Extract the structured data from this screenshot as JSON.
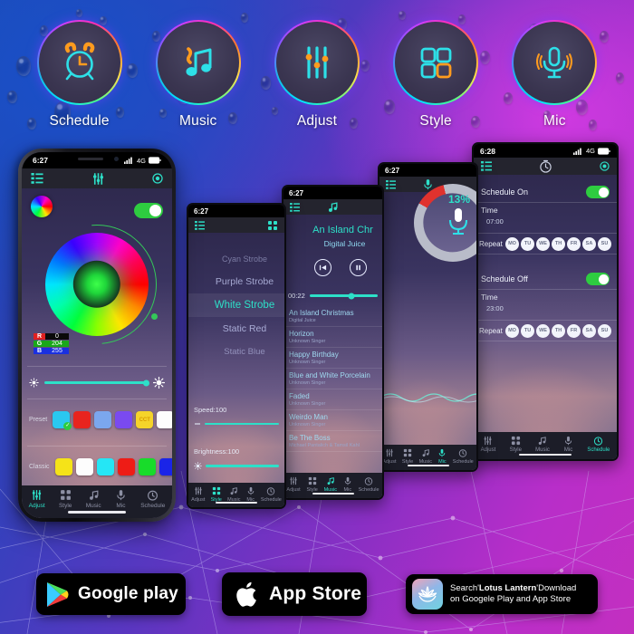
{
  "features": [
    {
      "label": "Schedule",
      "icon": "alarm-clock-icon"
    },
    {
      "label": "Music",
      "icon": "music-note-icon"
    },
    {
      "label": "Adjust",
      "icon": "sliders-icon"
    },
    {
      "label": "Style",
      "icon": "grid-squares-icon"
    },
    {
      "label": "Mic",
      "icon": "microphone-icon"
    }
  ],
  "nav": {
    "adjust": "Adjust",
    "style": "Style",
    "music": "Music",
    "mic": "Mic",
    "schedule": "Schedule"
  },
  "phone_adjust": {
    "status": {
      "time": "6:27",
      "network": "4G"
    },
    "rgb": {
      "r_key": "R",
      "r_val": "0",
      "g_key": "G",
      "g_val": "204",
      "b_key": "B",
      "b_val": "255"
    },
    "preset_label": "Preset",
    "classic_label": "Classic",
    "preset_colors": [
      "#2ac8f0",
      "#e8241e",
      "#7ba7ee",
      "#7a4af0",
      "#f5d42a",
      "#fdfdfd"
    ],
    "preset_cct_text": "CCT",
    "classic_colors": [
      "#f5e318",
      "#fdfdfd",
      "#25e6f5",
      "#ee1c16",
      "#18dc2a",
      "#1a24e8"
    ],
    "brightness_icon_left": "sun-small-icon",
    "brightness_icon_right": "sun-large-icon"
  },
  "phone_style": {
    "status": {
      "time": "6:27"
    },
    "items": [
      {
        "label": "Cyan Strobe",
        "selected": false
      },
      {
        "label": "Purple Strobe",
        "selected": false
      },
      {
        "label": "White Strobe",
        "selected": true
      },
      {
        "label": "Static Red",
        "selected": false
      },
      {
        "label": "Static Blue",
        "selected": false
      }
    ],
    "speed_label": "Speed:100",
    "brightness_label": "Brightness:100"
  },
  "phone_music": {
    "status": {
      "time": "6:27"
    },
    "track_title": "An Island Chr",
    "track_artist": "Digital Juice",
    "elapsed": "00:22",
    "songs": [
      {
        "name": "An Island Christmas",
        "artist": "Digital Juice"
      },
      {
        "name": "Horizon",
        "artist": "Unknown Singer"
      },
      {
        "name": "Happy Birthday",
        "artist": "Unknown Singer"
      },
      {
        "name": "Blue and White Porcelain",
        "artist": "Unknown Singer"
      },
      {
        "name": "Faded",
        "artist": "Unknown Singer"
      },
      {
        "name": "Weirdo Man",
        "artist": "Unknown Singer"
      },
      {
        "name": "Be The Boss",
        "artist": "Michael Pantalich & Tamsil Kahl"
      }
    ]
  },
  "phone_mic": {
    "status": {
      "time": "6:27"
    },
    "sensitivity": "13%"
  },
  "phone_schedule": {
    "status": {
      "time": "6:28",
      "network": "4G"
    },
    "on": {
      "label": "Schedule On",
      "time_label": "Time",
      "time_value": "07:00",
      "repeat_label": "Repeat",
      "enabled": true
    },
    "off": {
      "label": "Schedule Off",
      "time_label": "Time",
      "time_value": "23:00",
      "repeat_label": "Repeat",
      "enabled": true
    },
    "days": [
      "MO",
      "TU",
      "WE",
      "TH",
      "FR",
      "SA",
      "SU"
    ]
  },
  "stores": {
    "google_play": "Google play",
    "app_store": "App Store",
    "lotus_line1_pre": "Search'",
    "lotus_line1_bold": "Lotus Lantern",
    "lotus_line1_post": "'Download",
    "lotus_line2": "on Googele Play and App Store"
  },
  "colors": {
    "accent_cyan": "#2de0c8",
    "toggle_green": "#2ecc40",
    "bg_blue": "#1d49b4",
    "bg_magenta": "#c32fc0"
  }
}
